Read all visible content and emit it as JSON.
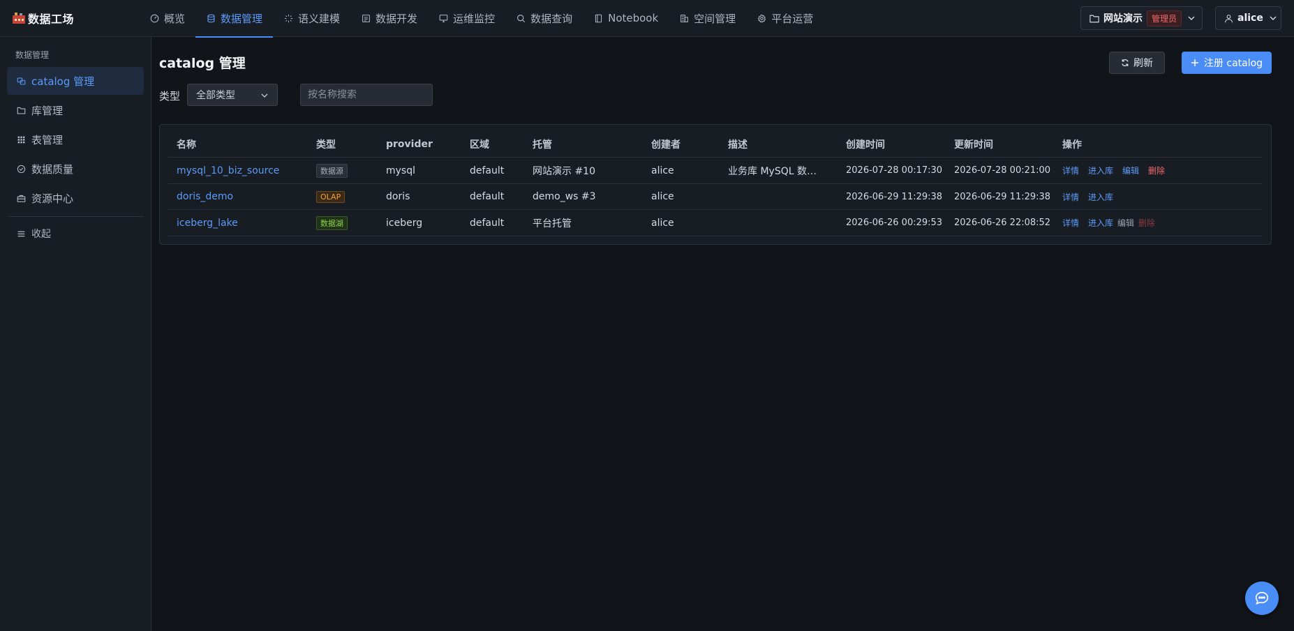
{
  "app": {
    "title": "数据工场"
  },
  "nav": [
    {
      "label": "概览",
      "icon": "dashboard-icon"
    },
    {
      "label": "数据管理",
      "icon": "database-icon",
      "active": true
    },
    {
      "label": "语义建模",
      "icon": "sparkle-icon"
    },
    {
      "label": "数据开发",
      "icon": "code-file-icon"
    },
    {
      "label": "运维监控",
      "icon": "monitor-icon"
    },
    {
      "label": "数据查询",
      "icon": "search-icon"
    },
    {
      "label": "Notebook",
      "icon": "notebook-icon"
    },
    {
      "label": "空间管理",
      "icon": "building-icon"
    },
    {
      "label": "平台运营",
      "icon": "gear-icon"
    }
  ],
  "workspace": {
    "name": "网站演示",
    "role": "管理员"
  },
  "user": {
    "name": "alice"
  },
  "sidebar": {
    "group": "数据管理",
    "items": [
      {
        "label": "catalog 管理",
        "icon": "catalog-icon",
        "active": true
      },
      {
        "label": "库管理",
        "icon": "folder-icon"
      },
      {
        "label": "表管理",
        "icon": "grid-icon"
      },
      {
        "label": "数据质量",
        "icon": "check-circle-icon"
      },
      {
        "label": "资源中心",
        "icon": "briefcase-icon"
      }
    ],
    "collapse": "收起"
  },
  "page": {
    "title": "catalog 管理",
    "refresh_label": "刷新",
    "register_label": "注册 catalog",
    "filter_label": "类型",
    "type_select": "全部类型",
    "search_placeholder": "按名称搜索"
  },
  "table": {
    "headers": [
      "名称",
      "类型",
      "provider",
      "区域",
      "托管",
      "创建者",
      "描述",
      "创建时间",
      "更新时间",
      "操作"
    ],
    "rows": [
      {
        "name": "mysql_10_biz_source",
        "type": "数据源",
        "provider": "mysql",
        "region": "default",
        "host": "网站演示 #10",
        "creator": "alice",
        "desc": "业务库 MySQL 数据…",
        "ctime": "2026-07-28 00:17:30",
        "utime": "2026-07-28 00:21:00",
        "ops": [
          "详情",
          "进入库",
          "编辑",
          "删除"
        ]
      },
      {
        "name": "doris_demo",
        "type": "OLAP",
        "provider": "doris",
        "region": "default",
        "host": "demo_ws #3",
        "creator": "alice",
        "desc": "",
        "ctime": "2026-06-29 11:29:38",
        "utime": "2026-06-29 11:29:38",
        "ops": [
          "详情",
          "进入库"
        ]
      },
      {
        "name": "iceberg_lake",
        "type": "数据湖",
        "provider": "iceberg",
        "region": "default",
        "host": "平台托管",
        "creator": "alice",
        "desc": "",
        "ctime": "2026-06-26 00:29:53",
        "utime": "2026-06-26 22:08:52",
        "ops": [
          "详情",
          "进入库",
          "编辑",
          "删除"
        ]
      }
    ]
  },
  "colors": {
    "accent": "#4a8df7",
    "danger": "#f06a6a",
    "background": "#111419",
    "panel": "#181c23"
  }
}
